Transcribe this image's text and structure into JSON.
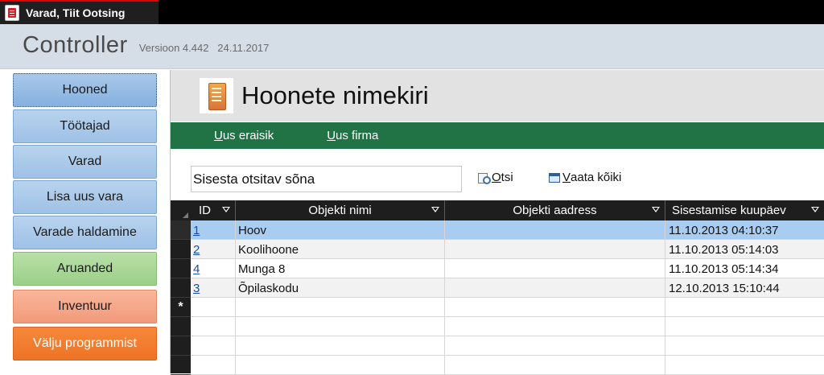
{
  "window": {
    "tab_title": "Varad, Tiit Ootsing"
  },
  "header": {
    "app_name": "Controller",
    "version": "Versioon 4.442   24.11.2017"
  },
  "sidebar": {
    "items": [
      {
        "label": "Hooned",
        "active": true
      },
      {
        "label": "Töötajad"
      },
      {
        "label": "Varad"
      },
      {
        "label": "Lisa uus vara"
      },
      {
        "label": "Varade haldamine"
      },
      {
        "label": "Aruanded"
      },
      {
        "label": "Inventuur"
      },
      {
        "label": "Välju programmist"
      }
    ]
  },
  "form": {
    "title": "Hoonete nimekiri",
    "actions": {
      "new_person_key": "U",
      "new_person_rest": "us eraisik",
      "new_company_key": "U",
      "new_company_rest": "us firma"
    },
    "search": {
      "value": "Sisesta otsitav sõna",
      "search_key": "O",
      "search_rest": "tsi",
      "view_all_key": "V",
      "view_all_rest": "aata kõiki"
    },
    "table": {
      "columns": [
        "ID",
        "Objekti nimi",
        "Objekti aadress",
        "Sisestamise kuupäev"
      ],
      "rows": [
        {
          "id": "1",
          "name": "Hoov",
          "address": "",
          "date": "11.10.2013 04:10:37"
        },
        {
          "id": "2",
          "name": "Koolihoone",
          "address": "",
          "date": "11.10.2013 05:14:03"
        },
        {
          "id": "4",
          "name": "Munga 8",
          "address": "",
          "date": "11.10.2013 05:14:34"
        },
        {
          "id": "3",
          "name": "Õpilaskodu",
          "address": "",
          "date": "12.10.2013 15:10:44"
        }
      ],
      "new_row_marker": "*"
    }
  },
  "colors": {
    "ribbon_green": "#217346",
    "selected_row": "#a9cdf1",
    "nav_blue": "#9ec1e6",
    "nav_green": "#9ccf88",
    "nav_salmon": "#f19a79",
    "nav_orange": "#ee7325"
  }
}
